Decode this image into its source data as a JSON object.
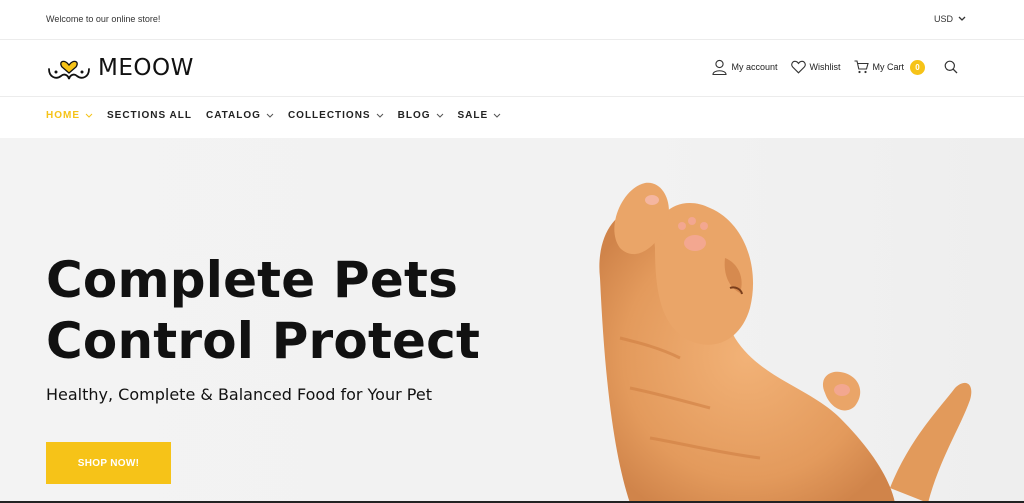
{
  "topbar": {
    "welcome": "Welcome to our online store!",
    "currency": "USD"
  },
  "header": {
    "logo_text": "MEOOW",
    "account_label": "My account",
    "wishlist_label": "Wishlist",
    "cart_label": "My Cart",
    "cart_count": "0"
  },
  "nav": {
    "items": [
      {
        "label": "HOME",
        "has_dropdown": true,
        "active": true
      },
      {
        "label": "SECTIONS ALL",
        "has_dropdown": false,
        "active": false
      },
      {
        "label": "CATALOG",
        "has_dropdown": true,
        "active": false
      },
      {
        "label": "COLLECTIONS",
        "has_dropdown": true,
        "active": false
      },
      {
        "label": "BLOG",
        "has_dropdown": true,
        "active": false
      },
      {
        "label": "SALE",
        "has_dropdown": true,
        "active": false
      }
    ]
  },
  "hero": {
    "title_line1": "Complete Pets",
    "title_line2": "Control Protect",
    "subtitle": "Healthy, Complete & Balanced Food for Your Pet",
    "button_label": "SHOP NOW!"
  },
  "colors": {
    "accent": "#f6c318",
    "text": "#111111",
    "hero_bg": "#f2f2f2",
    "cat_fur": "#e9a064"
  }
}
